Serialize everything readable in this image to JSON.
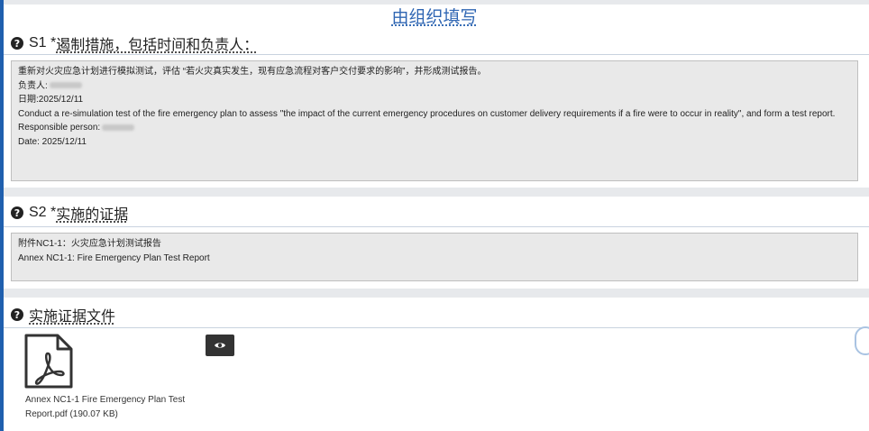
{
  "header": {
    "org_title": "由组织填写"
  },
  "s1": {
    "label": "S1 *",
    "title": "遏制措施，包括时间和负责人：",
    "lines": [
      "重新对火灾应急计划进行模拟测试，评估 “若火灾真实发生，现有应急流程对客户交付要求的影响”，并形成测试报告。",
      "负责人:",
      "日期:2025/12/11",
      "Conduct a re-simulation test of the fire emergency plan to assess \"the impact of the current emergency procedures on customer delivery requirements if a fire were to occur in reality\", and form a test report.",
      "Responsible person:",
      "Date: 2025/12/11"
    ]
  },
  "s2": {
    "label": "S2 *",
    "title": "实施的证据",
    "lines": [
      "附件NC1-1：火灾应急计划测试报告",
      "Annex NC1-1: Fire Emergency Plan Test Report"
    ]
  },
  "evidence": {
    "title": "实施证据文件",
    "file_name": "Annex NC1-1 Fire Emergency Plan Test Report.pdf (190.07 KB)"
  },
  "icons": {
    "help": "help-icon",
    "file": "pdf-file-icon",
    "view": "eye-icon"
  },
  "colors": {
    "accent": "#2f66b3",
    "left_bar": "#1f5fae",
    "box_bg": "#e9e9e9"
  }
}
